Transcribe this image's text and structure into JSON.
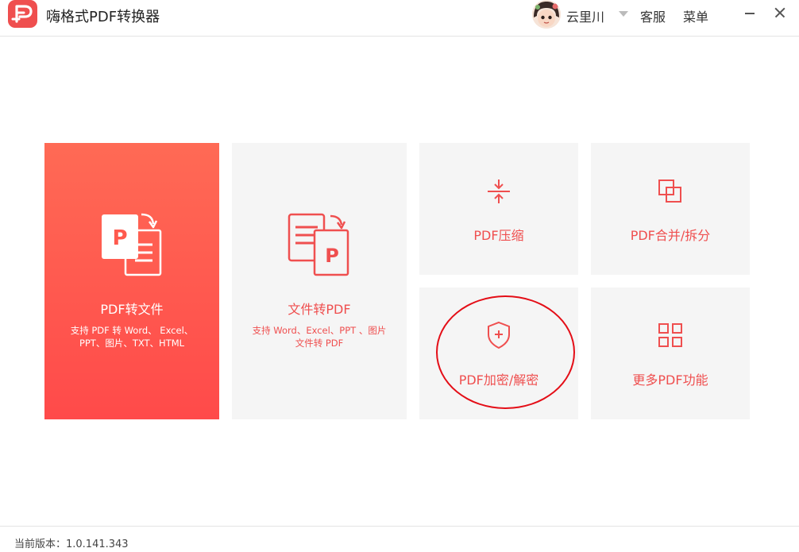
{
  "titlebar": {
    "app_title": "嗨格式PDF转换器",
    "user_name": "云里川",
    "service_label": "客服",
    "menu_label": "菜单"
  },
  "cards": {
    "pdf_to_file": {
      "title": "PDF转文件",
      "desc": "支持 PDF 转 Word、 Excel、 PPT、图片、TXT、HTML"
    },
    "file_to_pdf": {
      "title": "文件转PDF",
      "desc": "支持 Word、Excel、PPT 、图片文件转 PDF"
    },
    "compress": {
      "title": "PDF压缩"
    },
    "merge_split": {
      "title": "PDF合并/拆分"
    },
    "encrypt": {
      "title": "PDF加密/解密"
    },
    "more": {
      "title": "更多PDF功能"
    }
  },
  "footer": {
    "version": "当前版本：1.0.141.343"
  },
  "colors": {
    "brand": "#ef4f4f",
    "highlight_ring": "#e40e17",
    "card_bg": "#f5f5f5"
  },
  "icons": {
    "logo": "app-logo-icon",
    "pdf_to_file": "pdf-to-document-icon",
    "file_to_pdf": "document-to-pdf-icon",
    "compress": "compress-icon",
    "merge_split": "merge-split-icon",
    "encrypt": "shield-plus-icon",
    "more": "grid-apps-icon"
  }
}
